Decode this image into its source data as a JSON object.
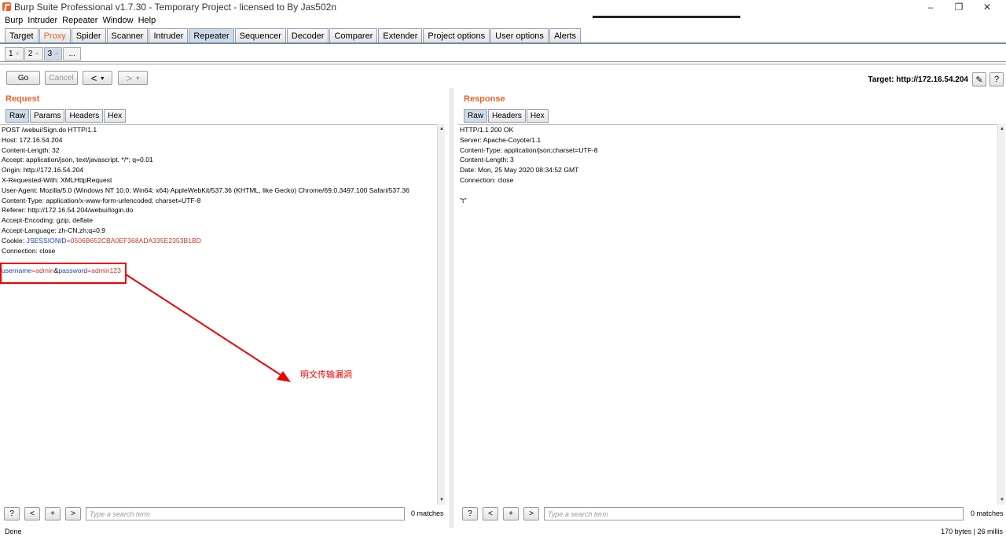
{
  "window": {
    "title": "Burp Suite Professional v1.7.30 - Temporary Project - licensed to By Jas502n",
    "minimize": "–",
    "maximize": "❐",
    "close": "✕"
  },
  "menu": [
    "Burp",
    "Intruder",
    "Repeater",
    "Window",
    "Help"
  ],
  "main_tabs": [
    "Target",
    "Proxy",
    "Spider",
    "Scanner",
    "Intruder",
    "Repeater",
    "Sequencer",
    "Decoder",
    "Comparer",
    "Extender",
    "Project options",
    "User options",
    "Alerts"
  ],
  "sub_tabs": [
    {
      "label": "1",
      "close": "×"
    },
    {
      "label": "2",
      "close": "×"
    },
    {
      "label": "3",
      "close": "×"
    },
    {
      "label": "..."
    }
  ],
  "toolbar": {
    "go_label": "Go",
    "cancel_label": "Cancel",
    "back_label": "<",
    "back_menu": "▾",
    "forward_label": ">",
    "forward_menu": "▾",
    "target_label": "Target: http://172.16.54.204",
    "edit_icon": "✎",
    "help_icon": "?"
  },
  "request": {
    "title": "Request",
    "tabs": [
      "Raw",
      "Params",
      "Headers",
      "Hex"
    ],
    "lines": [
      "POST /webui/Sign.do HTTP/1.1",
      "Host: 172.16.54.204",
      "Content-Length: 32",
      "Accept: application/json, text/javascript, */*; q=0.01",
      "Origin: http://172.16.54.204",
      "X-Requested-With: XMLHttpRequest",
      "User-Agent: Mozilla/5.0 (Windows NT 10.0; Win64; x64) AppleWebKit/537.36 (KHTML, like Gecko) Chrome/69.0.3497.100 Safari/537.36",
      "Content-Type: application/x-www-form-urlencoded; charset=UTF-8",
      "Referer: http://172.16.54.204/webui/login.do",
      "Accept-Encoding: gzip, deflate",
      "Accept-Language: zh-CN,zh;q=0.9"
    ],
    "cookie_prefix": "Cookie: ",
    "cookie_name": "JSESSIONID",
    "cookie_value": "=0506B652CBA0EF368ADA335E2353B1BD",
    "connection": "Connection: close",
    "body": {
      "k1": "username",
      "v1": "=admin",
      "amp": "&",
      "k2": "password",
      "v2": "=admin123"
    }
  },
  "response": {
    "title": "Response",
    "tabs": [
      "Raw",
      "Headers",
      "Hex"
    ],
    "lines": [
      "HTTP/1.1 200 OK",
      "Server: Apache-Coyote/1.1",
      "Content-Type: application/json;charset=UTF-8",
      "Content-Length: 3",
      "Date: Mon, 25 May 2020 08:34:52 GMT",
      "Connection: close",
      "",
      "\"t\""
    ]
  },
  "search": {
    "help": "?",
    "prev": "<",
    "add": "+",
    "next": ">",
    "placeholder": "Type a search term",
    "matches": "0 matches"
  },
  "status": {
    "left": "Done",
    "right": "170 bytes | 26 millis"
  },
  "annotation": {
    "text": "明文传输漏洞"
  },
  "colors": {
    "accent": "#e8632a",
    "annotation": "#ee0000",
    "key": "#1e3fbf",
    "value": "#c0392b"
  }
}
